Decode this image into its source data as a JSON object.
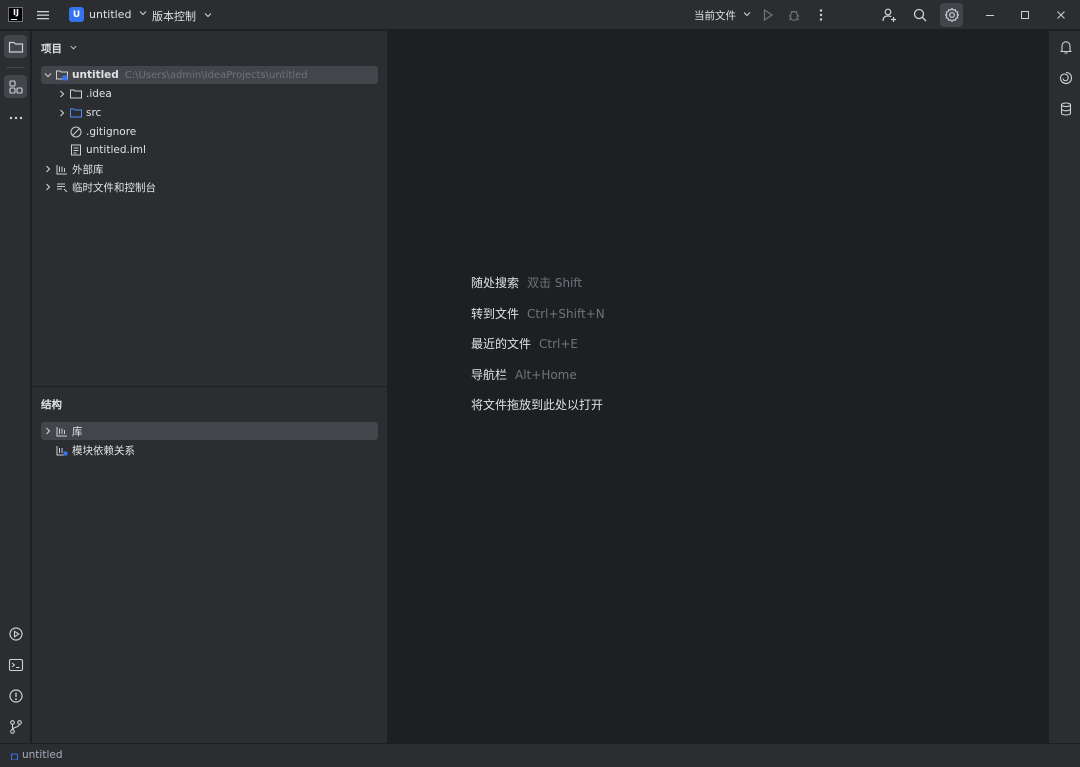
{
  "titlebar": {
    "project_badge": "U",
    "project_name": "untitled",
    "vcs_menu": "版本控制",
    "run_config": "当前文件"
  },
  "icons": {
    "left_strip": [
      "folder-icon",
      "structure-icon",
      "more-icon",
      "run-icon",
      "terminal-icon",
      "problems-icon",
      "git-icon"
    ],
    "right_strip": [
      "bell-icon",
      "ai-assistant-icon",
      "database-icon"
    ]
  },
  "project_panel": {
    "title": "项目",
    "tree": [
      {
        "label": "untitled",
        "hint": "C:\\Users\\admin\\IdeaProjects\\untitled",
        "expanded": true
      },
      {
        "label": ".idea"
      },
      {
        "label": "src"
      },
      {
        "label": ".gitignore"
      },
      {
        "label": "untitled.iml"
      },
      {
        "label": "外部库"
      },
      {
        "label": "临时文件和控制台"
      }
    ]
  },
  "structure_panel": {
    "title": "结构",
    "items": [
      {
        "label": "库"
      },
      {
        "label": "模块依赖关系"
      }
    ]
  },
  "editor_hints": [
    {
      "action": "随处搜索",
      "shortcut": "双击 Shift"
    },
    {
      "action": "转到文件",
      "shortcut": "Ctrl+Shift+N"
    },
    {
      "action": "最近的文件",
      "shortcut": "Ctrl+E"
    },
    {
      "action": "导航栏",
      "shortcut": "Alt+Home"
    },
    {
      "action": "将文件拖放到此处以打开",
      "shortcut": ""
    }
  ],
  "statusbar": {
    "breadcrumb": "untitled"
  },
  "colors": {
    "accent": "#3574f0",
    "panel_bg": "#2b2d30",
    "editor_bg": "#1e1f22",
    "selection": "#43454a"
  }
}
